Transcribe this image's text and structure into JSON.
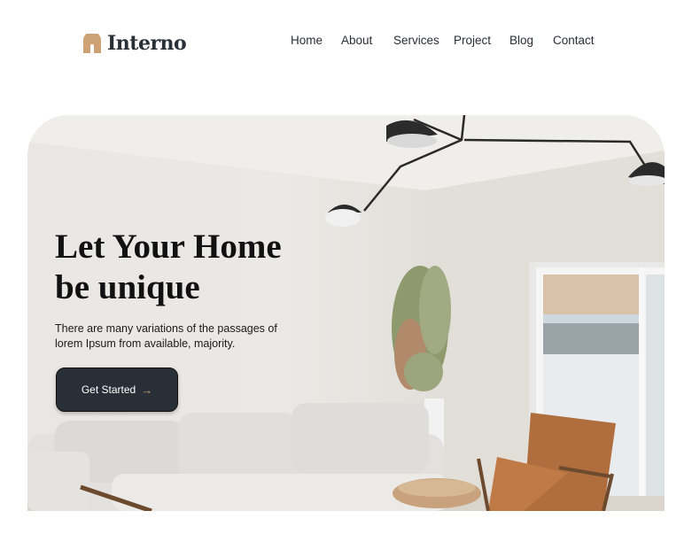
{
  "brand": {
    "name": "Interno",
    "accent": "#cda274"
  },
  "nav": {
    "items": [
      "Home",
      "About",
      "Services",
      "Project",
      "Blog",
      "Contact"
    ]
  },
  "hero": {
    "title_line1": "Let Your Home",
    "title_line2": "be unique",
    "description": "There are many variations of the passages of lorem Ipsum from available, majority.",
    "cta_label": "Get Started",
    "cta_icon": "arrow-right-icon",
    "button_color": "#292f36"
  }
}
